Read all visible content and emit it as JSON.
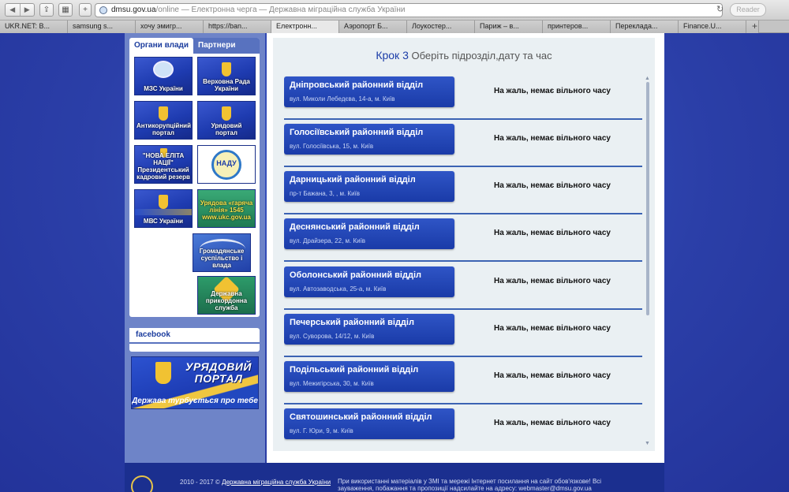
{
  "browser": {
    "url_domain": "dmsu.gov.ua",
    "url_path": "/online",
    "page_title": " — Електронна черга — Державна міграційна служба України",
    "reader_label": "Reader",
    "tabs": [
      "UKR.NET: В...",
      "samsung s...",
      "хочу эмигр...",
      "https://ban...",
      "Електронн...",
      "Аэропорт Б...",
      "Лоукостер...",
      "Париж – в...",
      "принтеров...",
      "Переклада...",
      "Finance.U..."
    ]
  },
  "sidebar": {
    "tab_authorities": "Органи влади",
    "tab_partners": "Партнери",
    "tiles": [
      {
        "label": "МЗС України"
      },
      {
        "label": "Верховна Рада України"
      },
      {
        "label": "Антикорупційний портал"
      },
      {
        "label": "Урядовий портал"
      },
      {
        "label": "\"НОВА ЕЛІТА НАЦІЇ\" Президентський кадровий резерв"
      },
      {
        "label": "НАДУ"
      },
      {
        "label": "МВС України"
      },
      {
        "label": "Урядова «гаряча лінія» 1545 www.ukc.gov.ua"
      },
      {
        "label": "Громадянське суспільство і влада"
      },
      {
        "label": "Державна прикордонна служба"
      }
    ],
    "facebook_label": "facebook",
    "banner_title": "УРЯДОВИЙ ПОРТАЛ",
    "banner_subtitle": "Держава турбується про тебе"
  },
  "main": {
    "step_label": "Крок 3",
    "step_text": "Оберіть підрозділ,дату та час",
    "departments": [
      {
        "name": "Дніпровський районний відділ",
        "address": "вул. Миколи Лебедєва, 14-а, м. Київ",
        "status": "На жаль, немає вільного часу"
      },
      {
        "name": "Голосіївський районний відділ",
        "address": "вул. Голосіївська, 15, м. Київ",
        "status": "На жаль, немає вільного часу"
      },
      {
        "name": "Дарницький районний відділ",
        "address": "пр-т Бажана, 3, , м. Київ",
        "status": "На жаль, немає вільного часу"
      },
      {
        "name": "Деснянський районний відділ",
        "address": "вул. Драйзера, 22, м. Київ",
        "status": "На жаль, немає вільного часу"
      },
      {
        "name": "Оболонський районний відділ",
        "address": "вул. Автозаводська, 25-а, м. Київ",
        "status": "На жаль, немає вільного часу"
      },
      {
        "name": "Печерський районний відділ",
        "address": "вул. Суворова, 14/12, м. Київ",
        "status": "На жаль, немає вільного часу"
      },
      {
        "name": "Подільський районний відділ",
        "address": "вул. Межигірська, 30, м. Київ",
        "status": "На жаль, немає вільного часу"
      },
      {
        "name": "Святошинський районний відділ",
        "address": "вул. Г. Юри, 9, м. Київ",
        "status": "На жаль, немає вільного часу"
      }
    ]
  },
  "footer": {
    "copyright": "2010 - 2017 ©",
    "org_link": "Державна міграційна служба України",
    "info": "При використанні матеріалів у ЗМІ та мережі Інтернет посилання на сайт обов'язкове! Всі зауваження, побажання та пропозиції надсилайте на адресу: webmaster@dmsu.gov.ua"
  },
  "colors": {
    "page_bg": "#2b3fa8",
    "department_button": "#2344b4",
    "divider": "#3c63b3",
    "accent_text": "#1c3da8"
  }
}
